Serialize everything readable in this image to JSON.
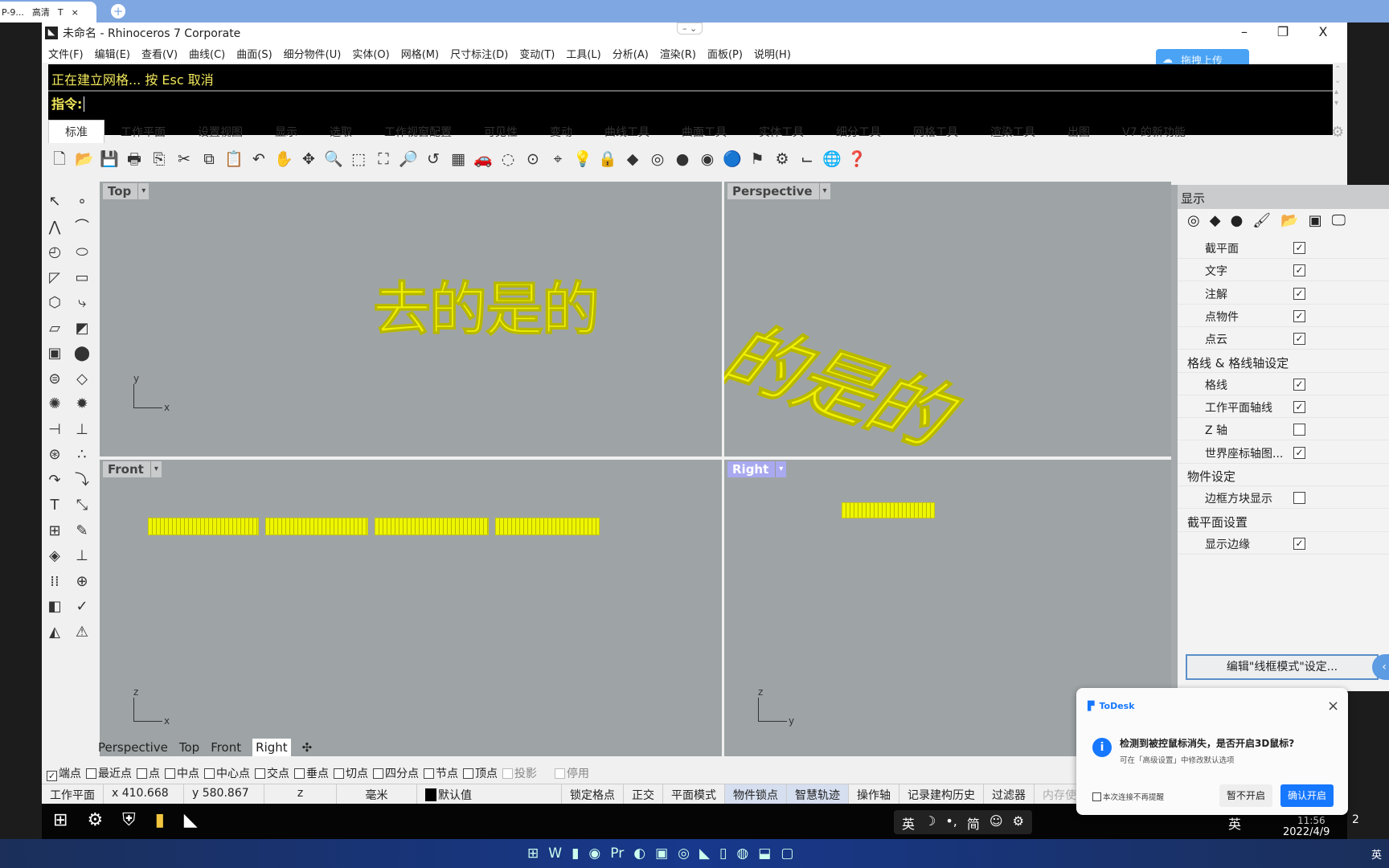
{
  "browser": {
    "tab_title": "P-9...",
    "tab_quality": "高清",
    "tab_t": "T",
    "close": "×",
    "new_tab": "+"
  },
  "window": {
    "title": "未命名 - Rhinoceros 7 Corporate",
    "minimize": "–",
    "restore": "❐",
    "close": "X",
    "center": "– ⌄"
  },
  "menu": [
    "文件(F)",
    "编辑(E)",
    "查看(V)",
    "曲线(C)",
    "曲面(S)",
    "细分物件(U)",
    "实体(O)",
    "网格(M)",
    "尺寸标注(D)",
    "变动(T)",
    "工具(L)",
    "分析(A)",
    "渲染(R)",
    "面板(P)",
    "说明(H)"
  ],
  "upload": {
    "label": "拖拽上传"
  },
  "command": {
    "history": "正在建立网格... 按 Esc 取消",
    "prompt": "指令:"
  },
  "tabs": [
    "标准",
    "工作平面",
    "设置视图",
    "显示",
    "选取",
    "工作视窗配置",
    "可见性",
    "变动",
    "曲线工具",
    "曲面工具",
    "实体工具",
    "细分工具",
    "网格工具",
    "渲染工具",
    "出图",
    "V7 的新功能"
  ],
  "toolbar": [
    [
      "new-icon",
      "🗋"
    ],
    [
      "open-icon",
      "📂"
    ],
    [
      "save-icon",
      "💾"
    ],
    [
      "print-icon",
      "🖶"
    ],
    [
      "export-icon",
      "⎘"
    ],
    [
      "cut-icon",
      "✂"
    ],
    [
      "copy-icon",
      "⧉"
    ],
    [
      "paste-icon",
      "📋"
    ],
    [
      "undo-icon",
      "↶"
    ],
    [
      "pan-icon",
      "✋"
    ],
    [
      "rotate-view-icon",
      "✥"
    ],
    [
      "zoom-icon",
      "🔍"
    ],
    [
      "zoom-window-icon",
      "⬚"
    ],
    [
      "zoom-extents-icon",
      "⛶"
    ],
    [
      "zoom-selected-icon",
      "🔎"
    ],
    [
      "undo-view-icon",
      "↺"
    ],
    [
      "viewport-layout-icon",
      "▦"
    ],
    [
      "car-icon",
      "🚗"
    ],
    [
      "hide-icon",
      "◌"
    ],
    [
      "show-icon",
      "⊙"
    ],
    [
      "select-icon",
      "⌖"
    ],
    [
      "light-icon",
      "💡"
    ],
    [
      "lock-icon",
      "🔒"
    ],
    [
      "layer-icon",
      "◆"
    ],
    [
      "color-wheel-icon",
      "◎"
    ],
    [
      "shade-icon",
      "●"
    ],
    [
      "render-icon",
      "◉"
    ],
    [
      "material-icon",
      "🔵"
    ],
    [
      "flag-icon",
      "⚑"
    ],
    [
      "options-icon",
      "⚙"
    ],
    [
      "dimension-icon",
      "⌙"
    ],
    [
      "globe-icon",
      "🌐"
    ],
    [
      "help-icon",
      "❓"
    ]
  ],
  "left_toolbar": [
    [
      "select-icon",
      "↖"
    ],
    [
      "point-icon",
      "∘"
    ],
    [
      "polyline-icon",
      "⋀"
    ],
    [
      "curve-icon",
      "⌒"
    ],
    [
      "circle-icon",
      "◴"
    ],
    [
      "ellipse-icon",
      "⬭"
    ],
    [
      "arc-icon",
      "◸"
    ],
    [
      "rectangle-icon",
      "▭"
    ],
    [
      "polygon-icon",
      "⬡"
    ],
    [
      "fillet-icon",
      "⤷"
    ],
    [
      "surface-icon",
      "▱"
    ],
    [
      "loft-icon",
      "◩"
    ],
    [
      "box-icon",
      "▣"
    ],
    [
      "sphere-icon",
      "⬤"
    ],
    [
      "cylinder-icon",
      "⊜"
    ],
    [
      "plane-icon",
      "◇"
    ],
    [
      "explode-icon",
      "✺"
    ],
    [
      "boolean-icon",
      "✹"
    ],
    [
      "trim-icon",
      "⊣"
    ],
    [
      "split-icon",
      "⊥"
    ],
    [
      "group-icon",
      "⊛"
    ],
    [
      "join-icon",
      "∴"
    ],
    [
      "offset-icon",
      "↷"
    ],
    [
      "blend-icon",
      "⤵"
    ],
    [
      "text-icon",
      "T"
    ],
    [
      "scale-icon",
      "⤡"
    ],
    [
      "array-icon",
      "⊞"
    ],
    [
      "edit-icon",
      "✎"
    ],
    [
      "mesh-icon",
      "◈"
    ],
    [
      "dim-icon",
      "⊥"
    ],
    [
      "grid-icon",
      "⁞⁞"
    ],
    [
      "snap-icon",
      "⊕"
    ],
    [
      "render-tool-icon",
      "◧"
    ],
    [
      "check-icon",
      "✓"
    ],
    [
      "material-tool-icon",
      "◭"
    ],
    [
      "paint-icon",
      "⚠"
    ]
  ],
  "viewports": {
    "top": {
      "label": "Top",
      "text": "去的是的",
      "ax1": "y",
      "ax2": "x"
    },
    "perspective": {
      "label": "Perspective",
      "text": "的是的"
    },
    "front": {
      "label": "Front",
      "ax1": "z",
      "ax2": "x"
    },
    "right": {
      "label": "Right",
      "ax1": "z",
      "ax2": "y"
    },
    "dropdown": "▾"
  },
  "viewport_tabs": [
    "Perspective",
    "Top",
    "Front",
    "Right"
  ],
  "viewport_tab_add": "✣",
  "osnaps": [
    [
      "端点",
      true
    ],
    [
      "最近点",
      false
    ],
    [
      "点",
      false
    ],
    [
      "中点",
      false
    ],
    [
      "中心点",
      false
    ],
    [
      "交点",
      false
    ],
    [
      "垂点",
      false
    ],
    [
      "切点",
      false
    ],
    [
      "四分点",
      false
    ],
    [
      "节点",
      false
    ],
    [
      "顶点",
      false
    ],
    [
      "投影",
      false
    ],
    [
      "停用",
      false
    ]
  ],
  "status": {
    "cplane": "工作平面",
    "x": "x 410.668",
    "y": "y 580.867",
    "z": "z",
    "units": "毫米",
    "layer": "默认值",
    "items": [
      "锁定格点",
      "正交",
      "平面模式",
      "物件锁点",
      "智慧轨迹",
      "操作轴",
      "记录建构历史",
      "过滤器"
    ],
    "memory": "内存使用量: 800 MB",
    "highlighted": [
      "物件锁点",
      "智慧轨迹"
    ]
  },
  "panel": {
    "title": "显示",
    "rows": [
      {
        "label": "截平面",
        "checked": true
      },
      {
        "label": "文字",
        "checked": true
      },
      {
        "label": "注解",
        "checked": true
      },
      {
        "label": "点物件",
        "checked": true
      },
      {
        "label": "点云",
        "checked": true
      },
      {
        "section": "格线 & 格线轴设定"
      },
      {
        "label": "格线",
        "checked": true
      },
      {
        "label": "工作平面轴线",
        "checked": true
      },
      {
        "label": "Z 轴",
        "checked": false
      },
      {
        "label": "世界座标轴图...",
        "checked": true
      },
      {
        "section": "物件设定"
      },
      {
        "label": "边框方块显示",
        "checked": false
      },
      {
        "section": "截平面设置"
      },
      {
        "label": "显示边缘",
        "checked": true
      }
    ],
    "button": "编辑\"线框模式\"设定...",
    "collapse": "‹",
    "tab_icons": [
      [
        "color-icon",
        "◎"
      ],
      [
        "layer-icon",
        "◆"
      ],
      [
        "material-icon",
        "●"
      ],
      [
        "render-icon",
        "🖌"
      ],
      [
        "files-icon",
        "📂"
      ],
      [
        "named-view-icon",
        "▣"
      ],
      [
        "display-icon",
        "🖵"
      ]
    ]
  },
  "todesk": {
    "brand": "ToDesk",
    "close": "×",
    "title": "检测到被控鼠标消失，是否开启3D鼠标?",
    "sub": "可在「高级设置」中修改默认选项",
    "checkbox": "本次连接不再提醒",
    "cancel": "暂不开启",
    "confirm": "确认开启",
    "accent": "#1677ff"
  },
  "inner_taskbar": {
    "ime": [
      "英",
      "☽",
      "•,",
      "简",
      "☺",
      "⚙"
    ],
    "tray": "英",
    "time": "11:56",
    "date": "2022/4/9",
    "notif": "2"
  },
  "outer_taskbar": {
    "ime": "英"
  }
}
